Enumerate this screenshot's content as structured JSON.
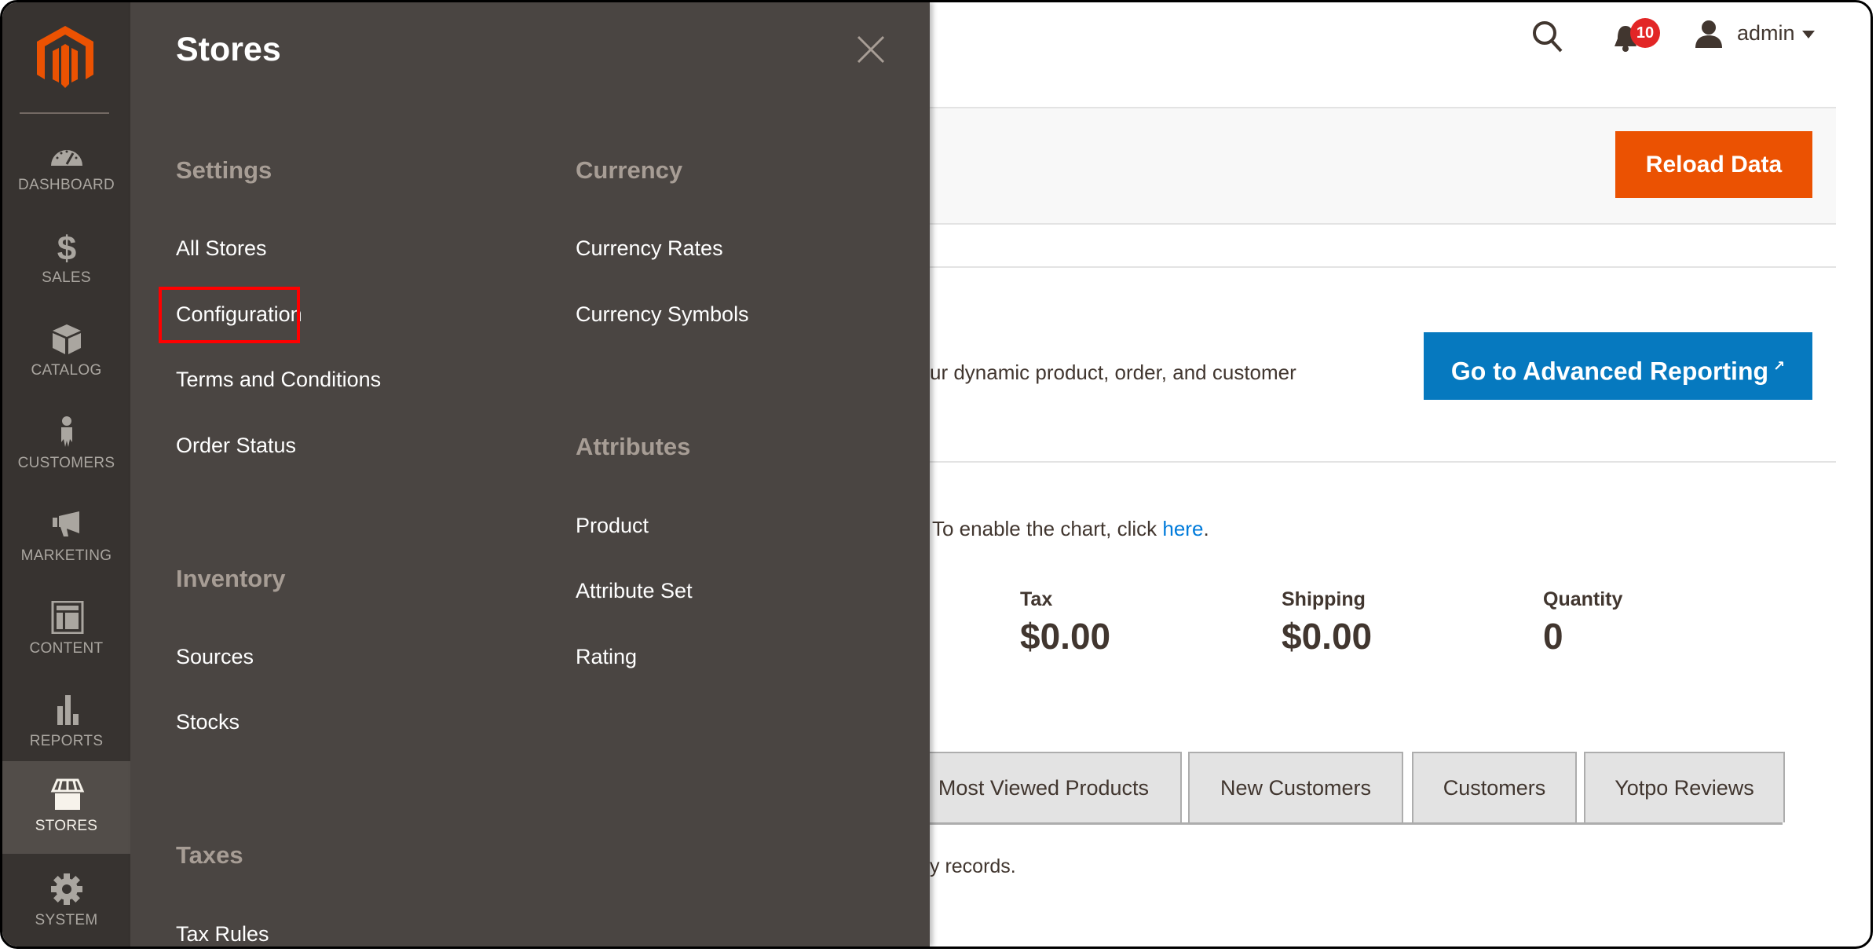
{
  "brand": {
    "accent": "#eb5202",
    "nav_bg": "#373330",
    "flyout_bg": "#4a4542",
    "link_blue": "#007bdb",
    "highlight": "#ff0000"
  },
  "nav": {
    "logo": "magento-logo-icon",
    "items": [
      {
        "label": "DASHBOARD",
        "icon": "dashboard-gauge-icon",
        "active": false
      },
      {
        "label": "SALES",
        "icon": "dollar-icon",
        "active": false
      },
      {
        "label": "CATALOG",
        "icon": "box-icon",
        "active": false
      },
      {
        "label": "CUSTOMERS",
        "icon": "person-icon",
        "active": false
      },
      {
        "label": "MARKETING",
        "icon": "megaphone-icon",
        "active": false
      },
      {
        "label": "CONTENT",
        "icon": "layout-icon",
        "active": false
      },
      {
        "label": "REPORTS",
        "icon": "bar-chart-icon",
        "active": false
      },
      {
        "label": "STORES",
        "icon": "storefront-icon",
        "active": true
      },
      {
        "label": "SYSTEM",
        "icon": "gear-icon",
        "active": false
      }
    ]
  },
  "flyout": {
    "title": "Stores",
    "close_icon": "close-icon",
    "sections": [
      {
        "heading": "Settings",
        "items": [
          "All Stores",
          "Configuration",
          "Terms and Conditions",
          "Order Status"
        ]
      },
      {
        "heading": "Inventory",
        "items": [
          "Sources",
          "Stocks"
        ]
      },
      {
        "heading": "Taxes",
        "items": [
          "Tax Rules"
        ]
      },
      {
        "heading": "Currency",
        "items": [
          "Currency Rates",
          "Currency Symbols"
        ]
      },
      {
        "heading": "Attributes",
        "items": [
          "Product",
          "Attribute Set",
          "Rating"
        ]
      }
    ],
    "highlighted_item": "Configuration"
  },
  "header": {
    "search_icon": "search-icon",
    "notifications_icon": "bell-icon",
    "notifications_count": "10",
    "user_icon": "user-icon",
    "user_name": "admin"
  },
  "main": {
    "reload_button": "Reload Data",
    "advanced_reporting_text": "ur dynamic product, order, and customer",
    "advanced_reporting_button": "Go to Advanced Reporting",
    "external_link_icon": "external-link-icon",
    "chart_message_prefix": "To enable the chart, click ",
    "chart_message_link": "here",
    "chart_message_suffix": ".",
    "stats": [
      {
        "label": "Tax",
        "value": "$0.00"
      },
      {
        "label": "Shipping",
        "value": "$0.00"
      },
      {
        "label": "Quantity",
        "value": "0"
      }
    ],
    "tabs": [
      "Most Viewed Products",
      "New Customers",
      "Customers",
      "Yotpo Reviews"
    ],
    "records_text": "y records."
  }
}
